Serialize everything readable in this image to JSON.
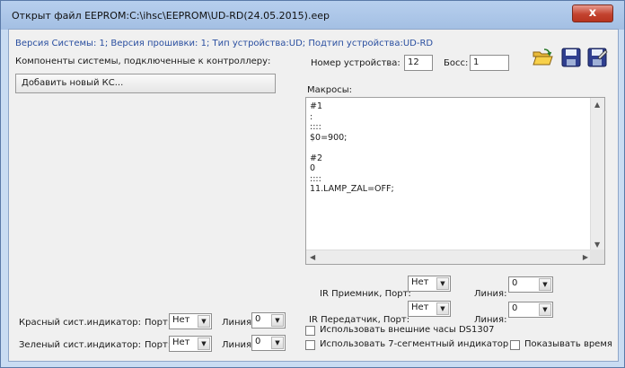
{
  "window": {
    "title": "Открыт файл EEPROM:C:\\ihsc\\EEPROM\\UD-RD(24.05.2015).eep",
    "close_label": "x"
  },
  "header": {
    "info_line": "Версия Системы: 1; Версия прошивки: 1; Тип устройства:UD; Подтип устройства:UD-RD",
    "components_label": "Компоненты системы, подключенные к контроллеру:",
    "add_button_label": "Добавить новый КС..."
  },
  "device": {
    "number_label": "Номер устройства:",
    "number_value": "12",
    "boss_label": "Босс:",
    "boss_value": "1"
  },
  "toolbar": {
    "open_icon": "folder-open-icon",
    "save_icon": "save-icon",
    "save_as_icon": "save-as-icon"
  },
  "macros": {
    "label": "Макросы:",
    "text": "#1\n:\n::::\n$0=900;\n\n#2\n0\n::::\n11.LAMP_ZAL=OFF;"
  },
  "ir_receiver": {
    "label": "IR Приемник, Порт:",
    "port_value": "Нет",
    "line_label": "Линия:",
    "line_value": "0"
  },
  "ir_transmitter": {
    "label": "IR Передатчик, Порт:",
    "port_value": "Нет",
    "line_label": "Линия:",
    "line_value": "0"
  },
  "red_indicator": {
    "label": "Красный сист.индикатор:",
    "port_label": "Порт:",
    "port_value": "Нет",
    "line_label": "Линия:",
    "line_value": "0"
  },
  "green_indicator": {
    "label": "Зеленый сист.индикатор:",
    "port_label": "Порт:",
    "port_value": "Нет",
    "line_label": "Линия:",
    "line_value": "0"
  },
  "options": {
    "ext_clock_label": "Использовать внешние часы DS1307",
    "seven_seg_label": "Использовать 7-сегментный индикатор",
    "show_time_label": "Показывать время"
  }
}
